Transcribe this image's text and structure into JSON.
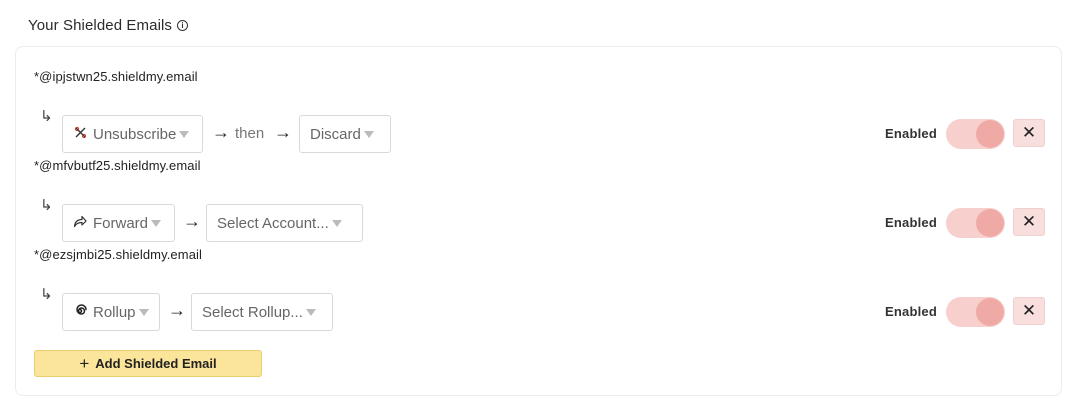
{
  "header": {
    "title": "Your Shielded Emails",
    "info_icon": "info-icon"
  },
  "rules": [
    {
      "email": "*@ipjstwn25.shieldmy.email",
      "action": {
        "icon": "unsubscribe-icon",
        "label": "Unsubscribe"
      },
      "then_label": "then",
      "target": {
        "label": "Discard"
      },
      "status_label": "Enabled",
      "enabled": true
    },
    {
      "email": "*@mfvbutf25.shieldmy.email",
      "action": {
        "icon": "forward-icon",
        "label": "Forward"
      },
      "target": {
        "label": "Select Account..."
      },
      "status_label": "Enabled",
      "enabled": true
    },
    {
      "email": "*@ezsjmbi25.shieldmy.email",
      "action": {
        "icon": "rollup-icon",
        "label": "Rollup"
      },
      "target": {
        "label": "Select Rollup..."
      },
      "status_label": "Enabled",
      "enabled": true
    }
  ],
  "add_button": {
    "label": "Add Shielded Email",
    "icon": "plus-icon"
  },
  "colors": {
    "toggle_track": "#f7d0ce",
    "toggle_knob": "#efaaa6",
    "close_bg": "#f9dede",
    "add_bg": "#fbe59a"
  }
}
